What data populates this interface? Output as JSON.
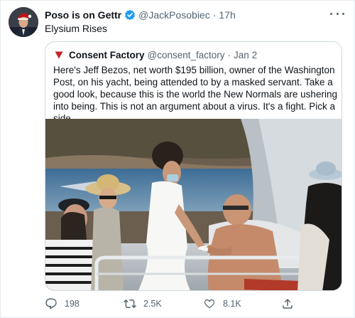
{
  "tweet": {
    "author_name": "Poso is on Gettr",
    "author_handle": "@JackPosobiec",
    "separator": "·",
    "time": "17h",
    "text": "Elysium Rises",
    "avatar_icon": "profile-photo-avatar",
    "verified_icon": "verified-badge-icon",
    "accent_color": "#1d9bf0"
  },
  "quoted_tweet": {
    "author_name": "Consent Factory",
    "author_handle": "@consent_factory",
    "separator": "·",
    "time": "Jan 2",
    "text": "Here's Jeff Bezos, net worth $195 billion, owner of the Washington Post, on his yacht, being attended to by a masked servant. Take a good look, because this is the world the New Normals are ushering into being. This is not an argument about a virus. It's a fight. Pick a side.",
    "avatar_icon": "red-triangle-logo",
    "media_icon": "yacht-photo"
  },
  "actions": {
    "reply_count": "198",
    "retweet_count": "2.5K",
    "like_count": "8.1K",
    "reply_icon": "reply-icon",
    "retweet_icon": "retweet-icon",
    "like_icon": "like-icon",
    "share_icon": "share-icon"
  }
}
